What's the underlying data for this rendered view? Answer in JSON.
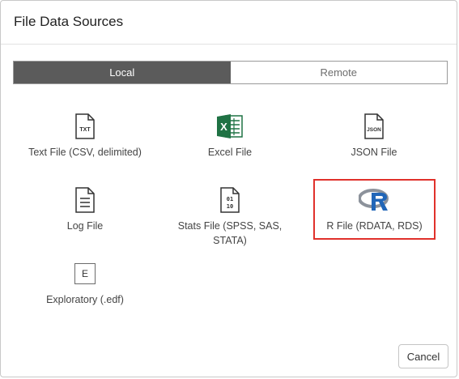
{
  "dialog": {
    "title": "File Data Sources"
  },
  "toggle": {
    "local": "Local",
    "remote": "Remote",
    "selected": "local"
  },
  "sources": [
    {
      "id": "text",
      "label": "Text File (CSV, delimited)",
      "icon": "txt-file-icon"
    },
    {
      "id": "excel",
      "label": "Excel File",
      "icon": "excel-icon"
    },
    {
      "id": "json",
      "label": "JSON File",
      "icon": "json-file-icon"
    },
    {
      "id": "log",
      "label": "Log File",
      "icon": "log-file-icon"
    },
    {
      "id": "stats",
      "label": "Stats File (SPSS, SAS, STATA)",
      "icon": "binary-file-icon"
    },
    {
      "id": "r",
      "label": "R File (RDATA, RDS)",
      "icon": "r-logo-icon",
      "highlighted": true
    },
    {
      "id": "edf",
      "label": "Exploratory (.edf)",
      "icon": "exploratory-e-icon",
      "icon_text": "E"
    }
  ],
  "footer": {
    "cancel_label": "Cancel"
  },
  "colors": {
    "active_toggle": "#5b5b5b",
    "highlight_border": "#e0312b",
    "excel_green": "#1f7244",
    "r_blue": "#2166b8"
  }
}
